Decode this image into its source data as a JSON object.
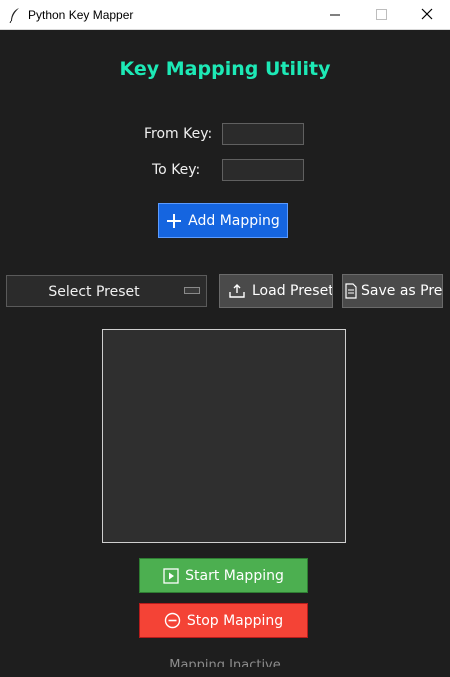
{
  "window": {
    "title": "Python Key Mapper",
    "minimize_icon": "minimize-icon",
    "maximize_icon": "maximize-icon",
    "close_icon": "close-icon"
  },
  "heading": "Key Mapping Utility",
  "form": {
    "from_label": "From Key:",
    "from_value": "",
    "to_label": "To Key:",
    "to_value": "",
    "add_button": "Add Mapping",
    "add_icon": "plus-icon"
  },
  "presets": {
    "select_value": "Select Preset",
    "load_button": "Load Preset",
    "load_icon": "tray-upload-icon",
    "save_button": "Save as Preset",
    "save_icon": "document-icon"
  },
  "mappings": [],
  "controls": {
    "start_button": "Start Mapping",
    "start_icon": "play-icon",
    "stop_button": "Stop Mapping",
    "stop_icon": "stop-circle-icon"
  },
  "status": "Mapping Inactive",
  "colors": {
    "background": "#1e1e1e",
    "accent_heading": "#1de9b6",
    "add_button": "#1565e0",
    "start_button": "#4caf50",
    "stop_button": "#f44336",
    "secondary_button": "#4a4a4a"
  }
}
